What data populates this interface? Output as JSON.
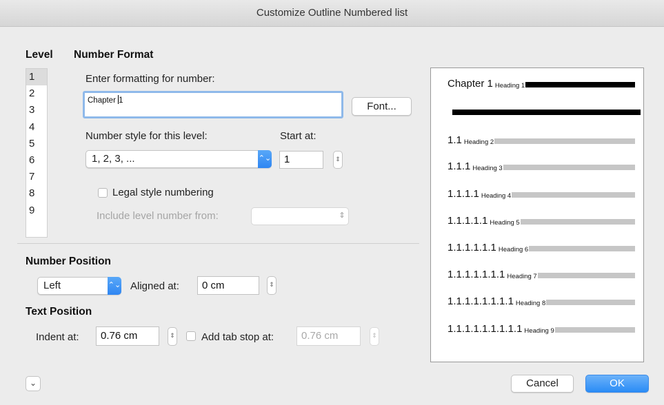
{
  "window": {
    "title": "Customize Outline Numbered list"
  },
  "level": {
    "heading": "Level",
    "items": [
      "1",
      "2",
      "3",
      "4",
      "5",
      "6",
      "7",
      "8",
      "9"
    ],
    "selected": "1"
  },
  "number_format": {
    "heading": "Number Format",
    "enter_label": "Enter formatting for number:",
    "format_value_prefix": "Chapter ",
    "format_value_suffix": "1",
    "font_button": "Font...",
    "style_label": "Number style for this level:",
    "style_value": "1, 2, 3, ...",
    "start_label": "Start at:",
    "start_value": "1",
    "legal_label": "Legal style numbering",
    "include_label": "Include level number from:",
    "include_value": ""
  },
  "number_position": {
    "heading": "Number Position",
    "align_value": "Left",
    "aligned_label": "Aligned at:",
    "aligned_value": "0 cm"
  },
  "text_position": {
    "heading": "Text Position",
    "indent_label": "Indent at:",
    "indent_value": "0.76 cm",
    "tab_label": "Add tab stop at:",
    "tab_value": "0.76 cm"
  },
  "preview": {
    "lines": [
      {
        "num": "Chapter 1",
        "head": "Heading 1"
      },
      {
        "num": "1.1",
        "head": "Heading 2"
      },
      {
        "num": "1.1.1",
        "head": "Heading 3"
      },
      {
        "num": "1.1.1.1",
        "head": "Heading 4"
      },
      {
        "num": "1.1.1.1.1",
        "head": "Heading 5"
      },
      {
        "num": "1.1.1.1.1.1",
        "head": "Heading 6"
      },
      {
        "num": "1.1.1.1.1.1.1",
        "head": "Heading 7"
      },
      {
        "num": "1.1.1.1.1.1.1.1",
        "head": "Heading 8"
      },
      {
        "num": "1.1.1.1.1.1.1.1.1",
        "head": "Heading 9"
      }
    ]
  },
  "buttons": {
    "cancel": "Cancel",
    "ok": "OK"
  },
  "icons": {
    "select_arrow": "updown-chevron-icon",
    "stepper": "stepper-icon",
    "disclosure": "chevron-down-icon"
  },
  "colors": {
    "accent": "#2a8cf6",
    "focus_ring": "#8fb9ea"
  }
}
